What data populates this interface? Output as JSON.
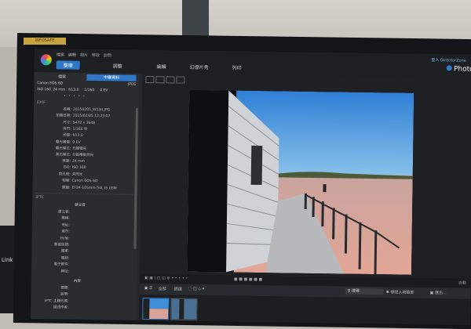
{
  "menu": [
    "檔案",
    "編輯",
    "相片",
    "特效",
    "說明"
  ],
  "tabs": [
    "整理",
    "調整",
    "編輯",
    "幻燈片秀",
    "列印"
  ],
  "login": "登入 DirectorZone",
  "brand": "Photo",
  "panel_tabs": [
    "檔案",
    "中繼資料"
  ],
  "camera": {
    "model": "Canon EOS 6D",
    "format": "JPEG"
  },
  "stats": [
    "ISO 160",
    "24 mm",
    "f/13.0",
    "1/160",
    "0 EV"
  ],
  "stars": "• • • • •",
  "sections": {
    "exif": "EXIF",
    "iptc": "IPTC"
  },
  "exif": [
    {
      "k": "名稱:",
      "v": "20150205_W134.JPG"
    },
    {
      "k": "拍攝日期:",
      "v": "2015/02/05 12:23:07"
    },
    {
      "k": "尺寸:",
      "v": "5472 x 3648"
    },
    {
      "k": "快門:",
      "v": "1/160 秒"
    },
    {
      "k": "光圈:",
      "v": "f/13.0"
    },
    {
      "k": "曝光補償:",
      "v": "0 EV"
    },
    {
      "k": "曝光模式:",
      "v": "光圈優先"
    },
    {
      "k": "測光模式:",
      "v": "分區權衡測光"
    },
    {
      "k": "焦距:",
      "v": "24 mm"
    },
    {
      "k": "ISO:",
      "v": "ISO 160"
    },
    {
      "k": "閃光燈:",
      "v": "未閃光"
    },
    {
      "k": "相機:",
      "v": "Canon EOS 6D"
    },
    {
      "k": "鏡頭:",
      "v": "EF24-105mm f/4L IS USM"
    }
  ],
  "iptc_title": "建立者",
  "iptc": [
    "建立者:",
    "職稱:",
    "地址:",
    "城市:",
    "州/省:",
    "郵遞區號:",
    "國家:",
    "電話:",
    "電子郵件:",
    "網址:"
  ],
  "content_title": "內容",
  "content": [
    "標題:",
    "說明:",
    "IPTC 主題代碼:",
    "描述作者:"
  ],
  "bottombar": {
    "label": "自動"
  },
  "filmbar": {
    "items": [
      "全部",
      "篩選"
    ],
    "search_placeholder": "搜尋",
    "tag_label": "標記人物臉部",
    "import_label": "匯出..."
  },
  "colors": {
    "accent": "#2e78c7",
    "sky": "#3f8fd8",
    "sand": "#d9a39a"
  }
}
